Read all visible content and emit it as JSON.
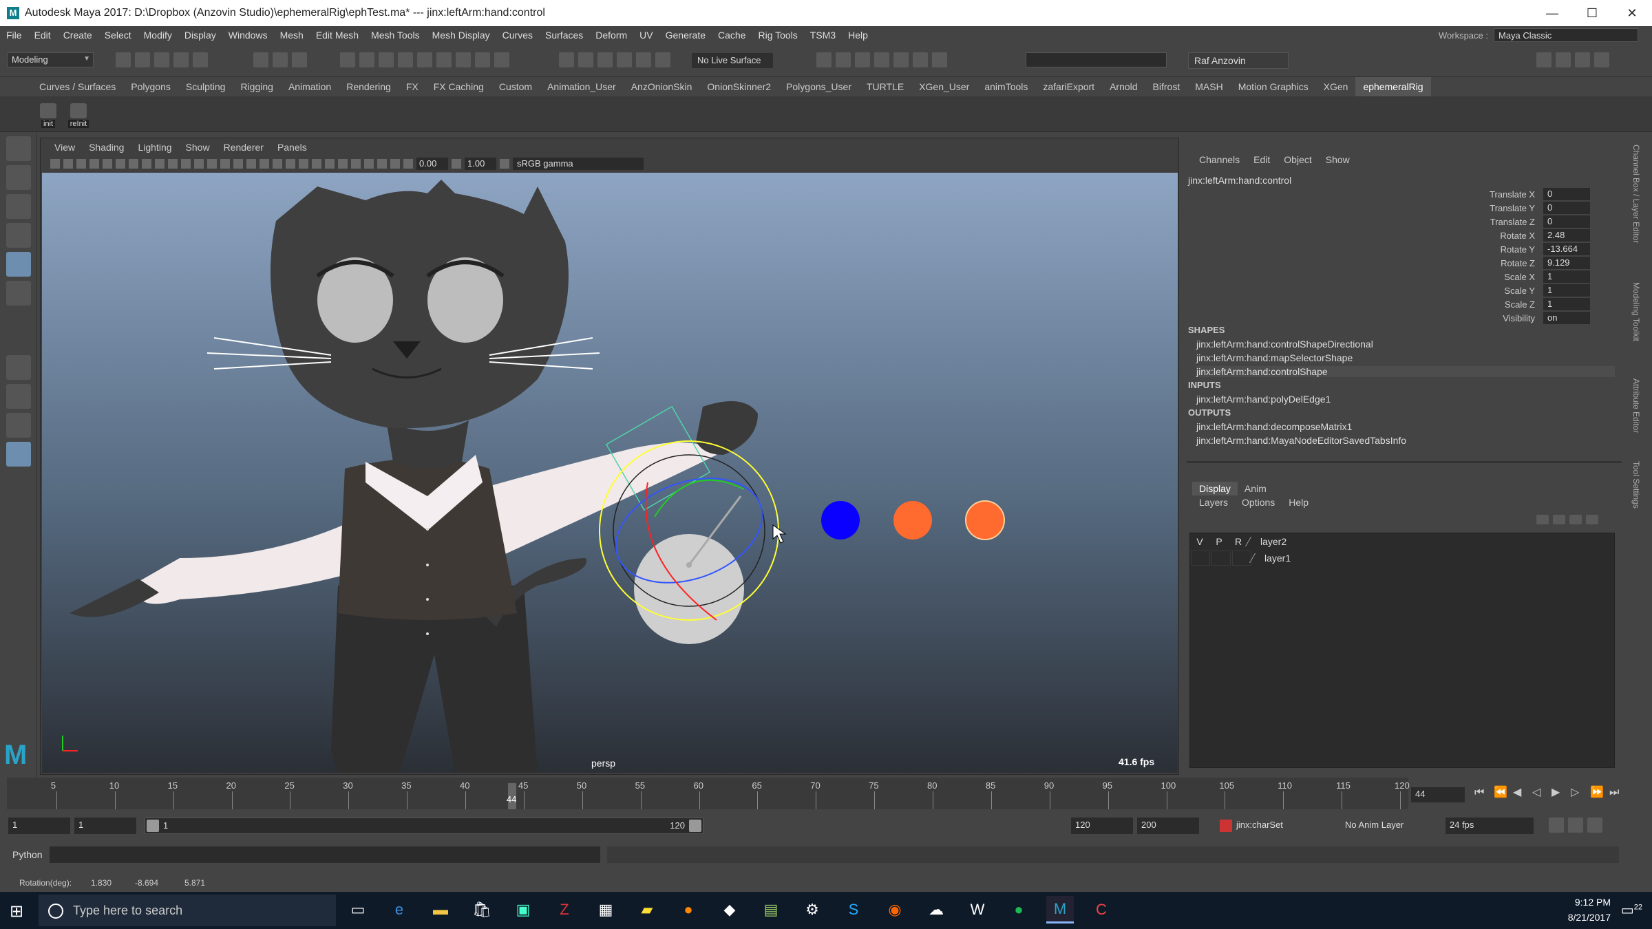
{
  "window": {
    "title": "Autodesk Maya 2017: D:\\Dropbox (Anzovin Studio)\\ephemeralRig\\ephTest.ma*   ---   jinx:leftArm:hand:control",
    "minimize": "—",
    "maximize": "☐",
    "close": "✕"
  },
  "menubar": {
    "items": [
      "File",
      "Edit",
      "Create",
      "Select",
      "Modify",
      "Display",
      "Windows",
      "Mesh",
      "Edit Mesh",
      "Mesh Tools",
      "Mesh Display",
      "Curves",
      "Surfaces",
      "Deform",
      "UV",
      "Generate",
      "Cache",
      "Rig Tools",
      "TSM3",
      "Help"
    ],
    "workspace_label": "Workspace :",
    "workspace_value": "Maya Classic"
  },
  "statusline": {
    "mode": "Modeling",
    "live_surface": "No Live Surface",
    "user": "Raf Anzovin"
  },
  "shelf": {
    "tabs": [
      "Curves / Surfaces",
      "Polygons",
      "Sculpting",
      "Rigging",
      "Animation",
      "Rendering",
      "FX",
      "FX Caching",
      "Custom",
      "Animation_User",
      "AnzOnionSkin",
      "OnionSkinner2",
      "Polygons_User",
      "TURTLE",
      "XGen_User",
      "animTools",
      "zafariExport",
      "Arnold",
      "Bifrost",
      "MASH",
      "Motion Graphics",
      "XGen",
      "ephemeralRig"
    ],
    "active_tab": "ephemeralRig",
    "buttons": [
      "init",
      "reInit"
    ]
  },
  "viewport": {
    "menu": [
      "View",
      "Shading",
      "Lighting",
      "Show",
      "Renderer",
      "Panels"
    ],
    "exposure": "0.00",
    "gamma": "1.00",
    "colorspace": "sRGB gamma",
    "camera": "persp",
    "fps": "41.6 fps"
  },
  "channelbox": {
    "menu": [
      "Channels",
      "Edit",
      "Object",
      "Show"
    ],
    "object": "jinx:leftArm:hand:control",
    "attributes": [
      {
        "name": "Translate X",
        "value": "0"
      },
      {
        "name": "Translate Y",
        "value": "0"
      },
      {
        "name": "Translate Z",
        "value": "0"
      },
      {
        "name": "Rotate X",
        "value": "2.48"
      },
      {
        "name": "Rotate Y",
        "value": "-13.664"
      },
      {
        "name": "Rotate Z",
        "value": "9.129"
      },
      {
        "name": "Scale X",
        "value": "1"
      },
      {
        "name": "Scale Y",
        "value": "1"
      },
      {
        "name": "Scale Z",
        "value": "1"
      },
      {
        "name": "Visibility",
        "value": "on"
      }
    ],
    "shapes_label": "SHAPES",
    "shapes": [
      "jinx:leftArm:hand:controlShapeDirectional",
      "jinx:leftArm:hand:mapSelectorShape",
      "jinx:leftArm:hand:controlShape"
    ],
    "inputs_label": "INPUTS",
    "inputs": [
      "jinx:leftArm:hand:polyDelEdge1"
    ],
    "outputs_label": "OUTPUTS",
    "outputs": [
      "jinx:leftArm:hand:decomposeMatrix1",
      "jinx:leftArm:hand:MayaNodeEditorSavedTabsInfo"
    ]
  },
  "layers": {
    "tabs": [
      "Display",
      "Anim"
    ],
    "menu": [
      "Layers",
      "Options",
      "Help"
    ],
    "header": [
      "V",
      "P",
      "R"
    ],
    "items": [
      "layer2",
      "layer1"
    ]
  },
  "side_tabs": [
    "Channel Box / Layer Editor",
    "Modeling Toolkit",
    "Attribute Editor",
    "Tool Settings"
  ],
  "timeline": {
    "ticks": [
      "5",
      "10",
      "15",
      "20",
      "25",
      "30",
      "35",
      "40",
      "45",
      "50",
      "55",
      "60",
      "65",
      "70",
      "75",
      "80",
      "85",
      "90",
      "95",
      "100",
      "105",
      "110",
      "115",
      "120"
    ],
    "current": "44",
    "current_field": "44"
  },
  "range": {
    "start": "1",
    "start2": "1",
    "slider_start": "1",
    "slider_end": "120",
    "end": "120",
    "end2": "200",
    "charset": "jinx:charSet",
    "anim_layer": "No Anim Layer",
    "fps": "24 fps"
  },
  "cmdline": {
    "label": "Python"
  },
  "helpline": {
    "label": "Rotation(deg):",
    "x": "1.830",
    "y": "-8.694",
    "z": "5.871"
  },
  "taskbar": {
    "search_placeholder": "Type here to search",
    "time": "9:12 PM",
    "date": "8/21/2017",
    "notifications": "22"
  },
  "colors": {
    "ball_blue": "#0a00ff",
    "ball_orange": "#ff6a2e",
    "viewport_top": "#8ea5c3",
    "viewport_bottom": "#2b2f36"
  }
}
